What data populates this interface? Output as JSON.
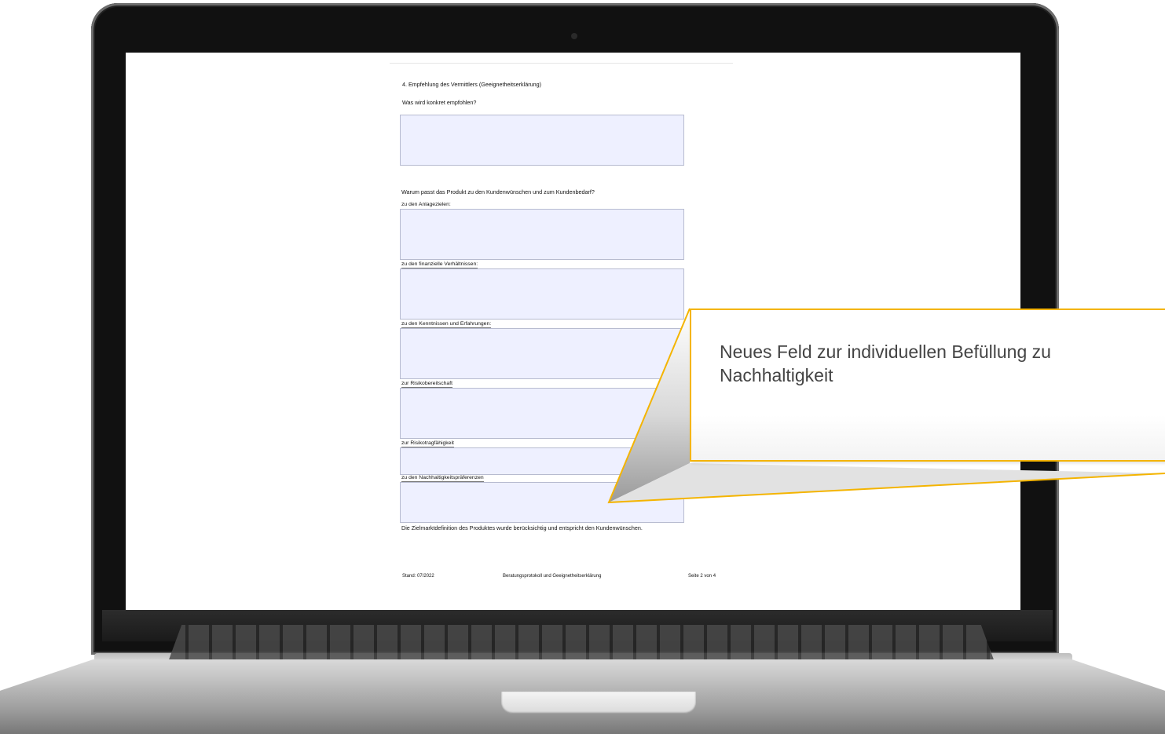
{
  "document": {
    "section_title": "4.  Empfehlung des Vermittlers (Geeignetheitserklärung)",
    "question_recommendation": "Was wird konkret empfohlen?",
    "question_fit": "Warum passt das Produkt zu den Kundenwünschen und zum Kundenbedarf?",
    "fields": [
      {
        "label": "zu den Anlagezielen:"
      },
      {
        "label": "zu den finanzielle Verhältnissen:"
      },
      {
        "label": "zu den Kenntnissen und Erfahrungen:"
      },
      {
        "label": "zur Risikobereitschaft"
      },
      {
        "label": "zur Risikotragfähigkeit"
      },
      {
        "label": "zu den Nachhaltigkeitspräferenzen"
      }
    ],
    "statement": "Die Zielmarktdefinition des Produktes wurde berücksichtig und entspricht den Kundenwünschen.",
    "footer": {
      "left": "Stand: 07/2022",
      "center": "Beratungsprotokoll und Geeignetheitserklärung",
      "right": "Seite 2 von 4"
    }
  },
  "callout": {
    "line1": "Neues Feld zur individuellen Befüllung zu",
    "line2": "Nachhaltigkeit",
    "border_color": "#f4b400"
  },
  "colors": {
    "field_fill": "#eef0ff",
    "field_border": "#b7bbd0",
    "bezel": "#111111",
    "accent": "#f4b400"
  }
}
